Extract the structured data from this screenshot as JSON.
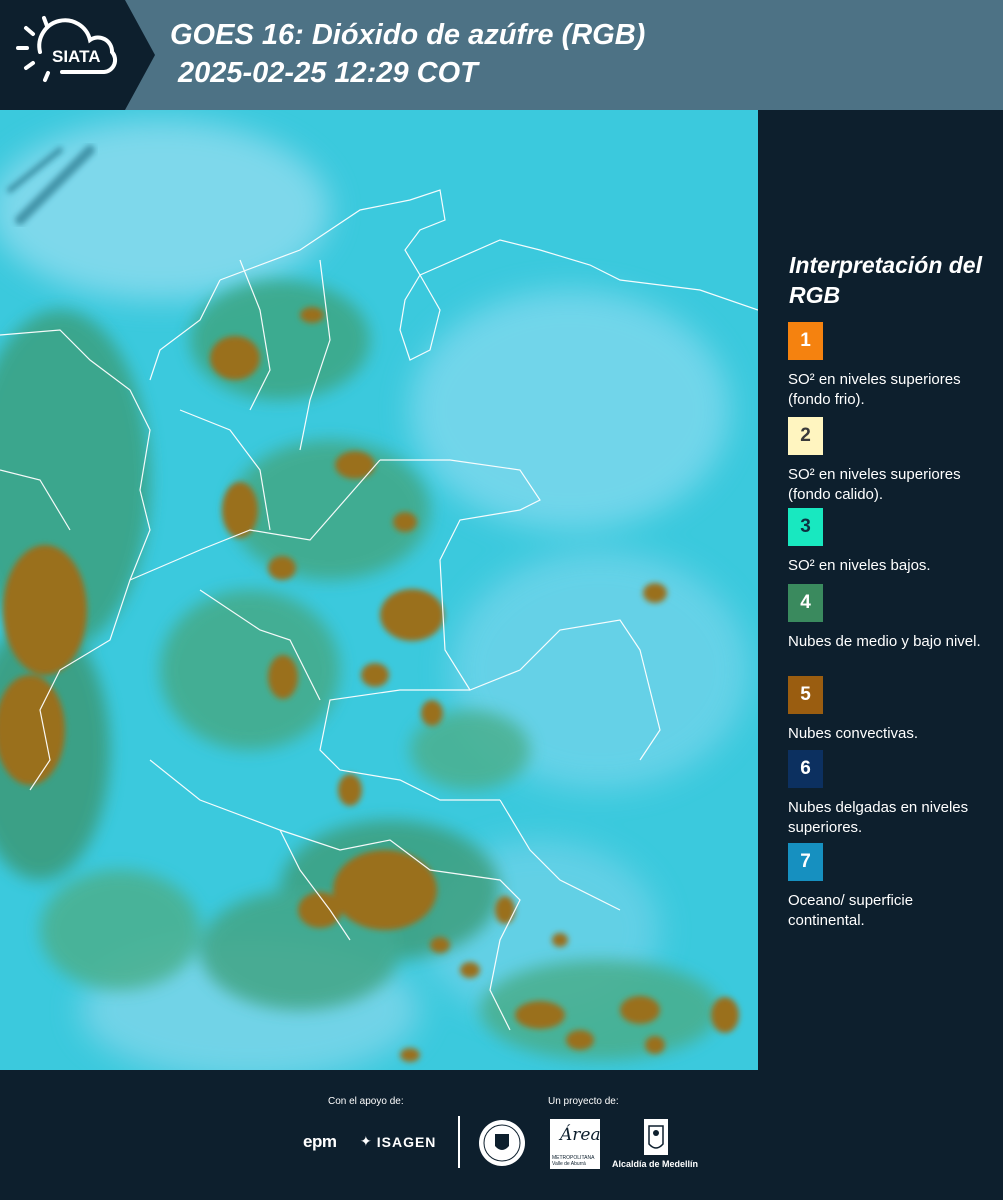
{
  "header": {
    "logo_text": "SIATA",
    "title_line1": "GOES 16: Dióxido de azúfre (RGB)",
    "title_line2": "2025-02-25 12:29 COT",
    "background_color": "#4d7285",
    "logo_background": "#0d1f2d"
  },
  "legend": {
    "title": "Interpretación del RGB",
    "items": [
      {
        "number": "1",
        "color": "#f5820f",
        "text": "SO² en niveles superiores (fondo frio)."
      },
      {
        "number": "2",
        "color": "#fff5c0",
        "text": "SO² en niveles superiores (fondo calido)."
      },
      {
        "number": "3",
        "color": "#18e8c0",
        "text": "SO² en niveles bajos."
      },
      {
        "number": "4",
        "color": "#3a8a5e",
        "text": "Nubes de medio y bajo nivel."
      },
      {
        "number": "5",
        "color": "#9a5d10",
        "text": "Nubes convectivas."
      },
      {
        "number": "6",
        "color": "#0c3060",
        "text": "Nubes delgadas en niveles superiores."
      },
      {
        "number": "7",
        "color": "#1690c0",
        "text": "Oceano/ superficie continental."
      }
    ]
  },
  "footer": {
    "support_label": "Con el apoyo de:",
    "project_label": "Un proyecto de:",
    "sponsors": [
      "epm",
      "ISAGEN"
    ],
    "area_logo_text": "Área",
    "area_logo_subtext": "METROPOLITANA Valle de Aburrá",
    "alcaldia_text": "Alcaldía de Medellín"
  }
}
